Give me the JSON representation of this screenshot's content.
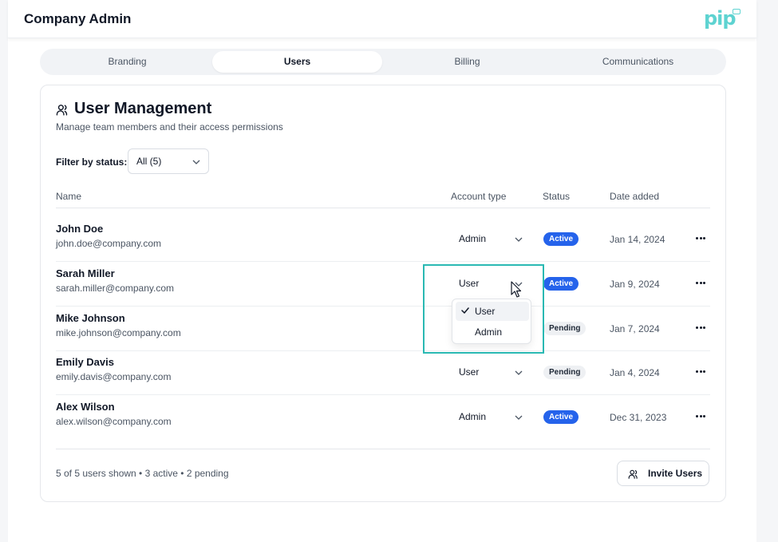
{
  "header": {
    "title": "Company Admin",
    "logo_text": "pip"
  },
  "tabs": [
    {
      "label": "Branding",
      "active": false
    },
    {
      "label": "Users",
      "active": true
    },
    {
      "label": "Billing",
      "active": false
    },
    {
      "label": "Communications",
      "active": false
    }
  ],
  "card": {
    "title": "User Management",
    "subtitle": "Manage team members and their access permissions",
    "filter_label": "Filter by status:",
    "filter_value": "All (5)"
  },
  "table": {
    "columns": [
      "Name",
      "Account type",
      "Status",
      "Date added"
    ],
    "rows": [
      {
        "name": "John Doe",
        "email": "john.doe@company.com",
        "account_type": "Admin",
        "status": "Active",
        "date": "Jan 14, 2024"
      },
      {
        "name": "Sarah Miller",
        "email": "sarah.miller@company.com",
        "account_type": "User",
        "status": "Active",
        "date": "Jan 9, 2024"
      },
      {
        "name": "Mike Johnson",
        "email": "mike.johnson@company.com",
        "account_type": "",
        "status": "Pending",
        "date": "Jan 7, 2024"
      },
      {
        "name": "Emily Davis",
        "email": "emily.davis@company.com",
        "account_type": "User",
        "status": "Pending",
        "date": "Jan 4, 2024"
      },
      {
        "name": "Alex Wilson",
        "email": "alex.wilson@company.com",
        "account_type": "Admin",
        "status": "Active",
        "date": "Dec 31, 2023"
      }
    ]
  },
  "dropdown": {
    "options": [
      "User",
      "Admin"
    ],
    "selected": "User"
  },
  "footer": {
    "summary": "5 of 5 users shown • 3 active • 2 pending",
    "invite_label": "Invite Users"
  },
  "colors": {
    "accent": "#2563eb",
    "highlight": "#2ab9b3",
    "logo": "#5ed3d1"
  }
}
